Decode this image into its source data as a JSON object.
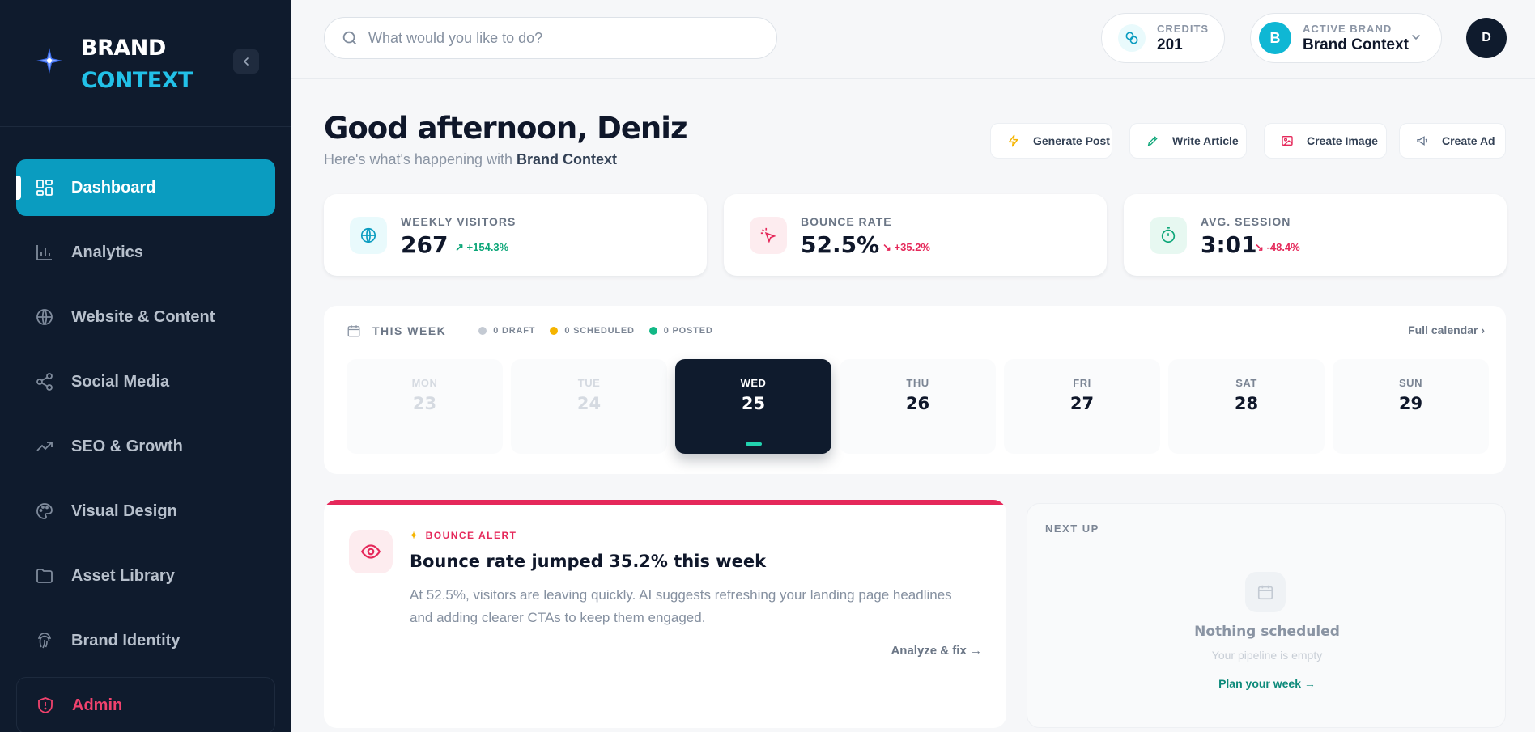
{
  "brand": {
    "line1": "BRAND",
    "line2": "CONTEXT",
    "accent": "#22c1e8",
    "sidebar_bg": "#0f1b2d"
  },
  "sidebar": {
    "items": [
      {
        "label": "Dashboard",
        "icon": "dashboard-icon",
        "active": true
      },
      {
        "label": "Analytics",
        "icon": "bar-chart-icon"
      },
      {
        "label": "Website & Content",
        "icon": "globe-icon"
      },
      {
        "label": "Social Media",
        "icon": "share-icon"
      },
      {
        "label": "SEO & Growth",
        "icon": "trending-up-icon"
      },
      {
        "label": "Visual Design",
        "icon": "palette-icon"
      },
      {
        "label": "Asset Library",
        "icon": "folder-icon"
      },
      {
        "label": "Brand Identity",
        "icon": "fingerprint-icon"
      },
      {
        "label": "Admin",
        "icon": "shield-icon"
      }
    ]
  },
  "header": {
    "search_placeholder": "What would you like to do?",
    "credits": {
      "label": "CREDITS",
      "value": "201"
    },
    "active_brand": {
      "label": "ACTIVE BRAND",
      "name": "Brand Context",
      "initial": "B"
    },
    "user_initial": "D"
  },
  "greeting": {
    "title": "Good afternoon, Deniz",
    "subtitle_prefix": "Here's what's happening with",
    "subtitle_brand": "Brand Context"
  },
  "quick_actions": [
    "Generate Post",
    "Write Article",
    "Create Image",
    "Create Ad"
  ],
  "stats": [
    {
      "label": "WEEKLY VISITORS",
      "value": "267",
      "delta": "+154.3%",
      "trend": "up",
      "color": "#0ca678"
    },
    {
      "label": "BOUNCE RATE",
      "value": "52.5%",
      "delta": "+35.2%",
      "trend": "down",
      "color": "#e5285a"
    },
    {
      "label": "AVG. SESSION",
      "value": "3:01",
      "delta": "-48.4%",
      "trend": "down",
      "color": "#e5285a"
    }
  ],
  "week": {
    "title": "THIS WEEK",
    "legend": [
      {
        "label": "0 DRAFT",
        "color": "#c4cad3"
      },
      {
        "label": "0 SCHEDULED",
        "color": "#f5b400"
      },
      {
        "label": "0 POSTED",
        "color": "#12b886"
      }
    ],
    "full_calendar": "Full calendar",
    "days": [
      {
        "name": "MON",
        "date": "23",
        "state": "past"
      },
      {
        "name": "TUE",
        "date": "24",
        "state": "past"
      },
      {
        "name": "WED",
        "date": "25",
        "state": "today"
      },
      {
        "name": "THU",
        "date": "26",
        "state": "future"
      },
      {
        "name": "FRI",
        "date": "27",
        "state": "future"
      },
      {
        "name": "SAT",
        "date": "28",
        "state": "future"
      },
      {
        "name": "SUN",
        "date": "29",
        "state": "future"
      }
    ]
  },
  "alert": {
    "tag": "BOUNCE ALERT",
    "title": "Bounce rate jumped 35.2% this week",
    "body": "At 52.5%, visitors are leaving quickly. AI suggests refreshing your landing page headlines and adding clearer CTAs to keep them engaged.",
    "action": "Analyze & fix",
    "color": "#e5285a"
  },
  "next_up": {
    "label": "NEXT UP",
    "title": "Nothing scheduled",
    "subtitle": "Your pipeline is empty",
    "action": "Plan your week"
  }
}
